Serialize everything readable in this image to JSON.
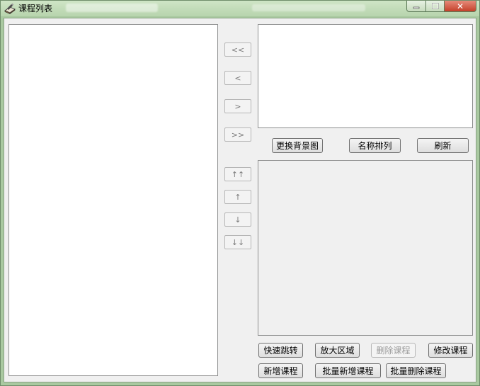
{
  "window": {
    "title": "课程列表",
    "close_symbol": "✕"
  },
  "arrows": {
    "first": "<<",
    "prev": "<",
    "next": ">",
    "last": ">>",
    "move_top": "↑↑",
    "move_up": "↑",
    "move_down": "↓",
    "move_bottom": "↓↓"
  },
  "buttons": {
    "change_background": "更换背景图",
    "sort_by_name": "名称排列",
    "refresh": "刷新",
    "quick_jump": "快速跳转",
    "zoom_area": "放大区域",
    "delete_course": "删除课程",
    "edit_course": "修改课程",
    "add_course": "新增课程",
    "batch_add_course": "批量新增课程",
    "batch_delete_course": "批量删除课程"
  },
  "colors": {
    "title_bar": "#b7d4ad",
    "close_button": "#c5412a",
    "panel_background": "#f0f0f0"
  }
}
